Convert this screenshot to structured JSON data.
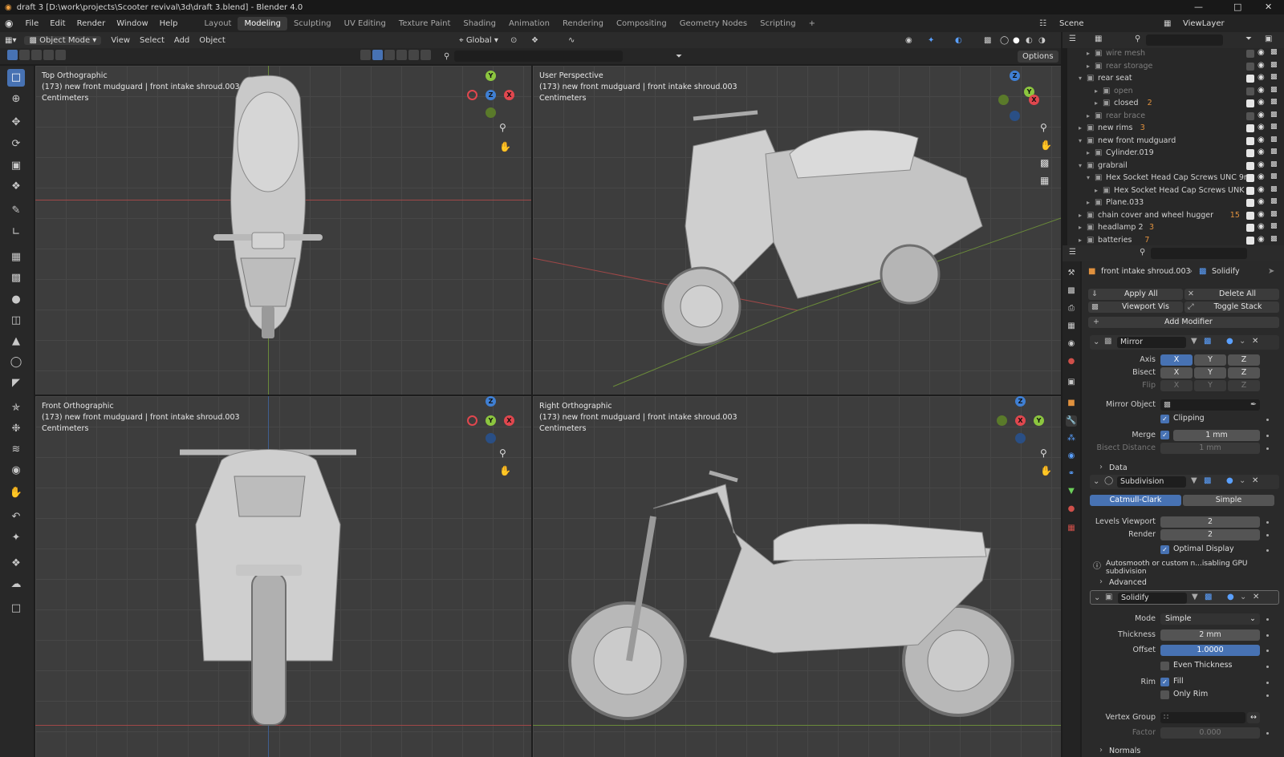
{
  "title_bar": {
    "text": "draft 3 [D:\\work\\projects\\Scooter revival\\3d\\draft 3.blend] - Blender 4.0"
  },
  "menus": [
    "File",
    "Edit",
    "Render",
    "Window",
    "Help"
  ],
  "workspaces": [
    "Layout",
    "Modeling",
    "Sculpting",
    "UV Editing",
    "Texture Paint",
    "Shading",
    "Animation",
    "Rendering",
    "Compositing",
    "Geometry Nodes",
    "Scripting"
  ],
  "active_workspace": "Modeling",
  "scene": {
    "label": "Scene",
    "view_layer": "ViewLayer"
  },
  "viewport_header": {
    "mode": "Object Mode",
    "menus": [
      "View",
      "Select",
      "Add",
      "Object"
    ],
    "orientation": "Global",
    "options": "Options"
  },
  "viewports": {
    "top": {
      "title": "Top Orthographic",
      "subtitle": "(173) new front mudguard | front intake shroud.003",
      "units": "Centimeters"
    },
    "persp": {
      "title": "User Perspective",
      "subtitle": "(173) new front mudguard | front intake shroud.003",
      "units": "Centimeters"
    },
    "front": {
      "title": "Front Orthographic",
      "subtitle": "(173) new front mudguard | front intake shroud.003",
      "units": "Centimeters"
    },
    "right": {
      "title": "Right Orthographic",
      "subtitle": "(173) new front mudguard | front intake shroud.003",
      "units": "Centimeters"
    }
  },
  "axis_labels": {
    "x": "X",
    "y": "Y",
    "z": "Z"
  },
  "outliner": {
    "rows": [
      {
        "name": "wire mesh",
        "dim": true,
        "checked": false,
        "badge": ""
      },
      {
        "name": "rear storage",
        "dim": true,
        "checked": false,
        "badge": ""
      },
      {
        "name": "rear seat",
        "dim": false,
        "checked": true,
        "badge": ""
      },
      {
        "name": "open",
        "dim": true,
        "checked": false,
        "badge": ""
      },
      {
        "name": "closed",
        "dim": false,
        "checked": true,
        "badge": "2"
      },
      {
        "name": "rear brace",
        "dim": true,
        "checked": false,
        "badge": ""
      },
      {
        "name": "new rims",
        "dim": false,
        "checked": true,
        "badge": "3"
      },
      {
        "name": "new front mudguard",
        "dim": false,
        "checked": true,
        "badge": ""
      },
      {
        "name": "Cylinder.019",
        "dim": false,
        "checked": true,
        "badge": ""
      },
      {
        "name": "grabrail",
        "dim": false,
        "checked": true,
        "badge": ""
      },
      {
        "name": "Hex Socket Head Cap Screws UNC 9n",
        "dim": false,
        "checked": true,
        "badge": ""
      },
      {
        "name": "Hex Socket Head Cap Screws UNK",
        "dim": false,
        "checked": true,
        "badge": ""
      },
      {
        "name": "Plane.033",
        "dim": false,
        "checked": true,
        "badge": ""
      },
      {
        "name": "chain cover and wheel hugger",
        "dim": false,
        "checked": true,
        "badge": "15"
      },
      {
        "name": "headlamp 2",
        "dim": false,
        "checked": true,
        "badge": "3"
      },
      {
        "name": "batteries",
        "dim": false,
        "checked": true,
        "badge": "7"
      }
    ]
  },
  "properties": {
    "breadcrumb_object": "front intake shroud.003",
    "breadcrumb_modifier": "Solidify",
    "apply_all": "Apply All",
    "delete_all": "Delete All",
    "viewport_vis": "Viewport Vis",
    "toggle_stack": "Toggle Stack",
    "add_modifier": "Add Modifier",
    "mirror": {
      "name": "Mirror",
      "axis_label": "Axis",
      "bisect_label": "Bisect",
      "flip_label": "Flip",
      "axes": [
        "X",
        "Y",
        "Z"
      ],
      "mirror_object_label": "Mirror Object",
      "clipping_label": "Clipping",
      "merge_label": "Merge",
      "merge_value": "1 mm",
      "bisect_distance_label": "Bisect Distance",
      "bisect_distance_value": "1 mm",
      "data_label": "Data"
    },
    "subdivision": {
      "name": "Subdivision",
      "catmull": "Catmull-Clark",
      "simple": "Simple",
      "levels_viewport_label": "Levels Viewport",
      "levels_viewport": "2",
      "render_label": "Render",
      "render": "2",
      "optimal_display": "Optimal Display",
      "warning": "Autosmooth or custom n...isabling GPU subdivision",
      "advanced_label": "Advanced"
    },
    "solidify": {
      "name": "Solidify",
      "mode_label": "Mode",
      "mode": "Simple",
      "thickness_label": "Thickness",
      "thickness": "2 mm",
      "offset_label": "Offset",
      "offset": "1.0000",
      "even_thickness": "Even Thickness",
      "rim_label": "Rim",
      "fill": "Fill",
      "only_rim": "Only Rim",
      "vertex_group_label": "Vertex Group",
      "factor_label": "Factor",
      "factor": "0.000",
      "normals_label": "Normals"
    }
  },
  "colors": {
    "accent": "#4772b3",
    "axis_x": "#e0474e",
    "axis_y": "#8cc63f",
    "axis_z": "#3f7fd3",
    "viewport_bg": "#3d3d3d"
  }
}
